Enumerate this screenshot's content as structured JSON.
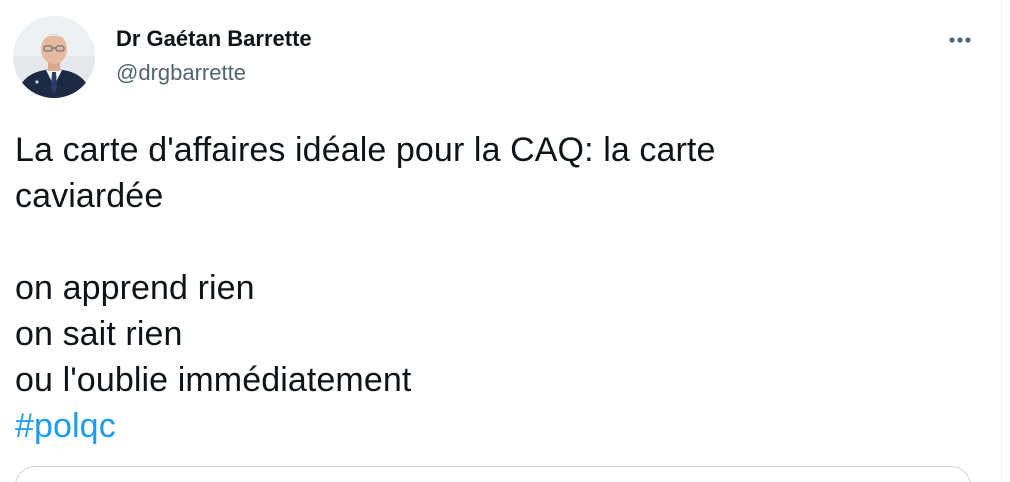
{
  "author": {
    "display_name": "Dr Gaétan Barrette",
    "handle": "@drgbarrette",
    "avatar_icon": "profile-photo"
  },
  "tweet": {
    "lines": [
      "La carte d'affaires idéale pour la CAQ: la carte",
      "caviardée",
      "",
      "on apprend rien",
      "on sait rien",
      "ou l'oublie immédiatement"
    ],
    "hashtag": "#polqc"
  },
  "actions": {
    "more_icon": "more-horizontal-icon"
  },
  "colors": {
    "text": "#0f1419",
    "secondary": "#536471",
    "link": "#1d9bf0",
    "border": "#cfd9de"
  }
}
